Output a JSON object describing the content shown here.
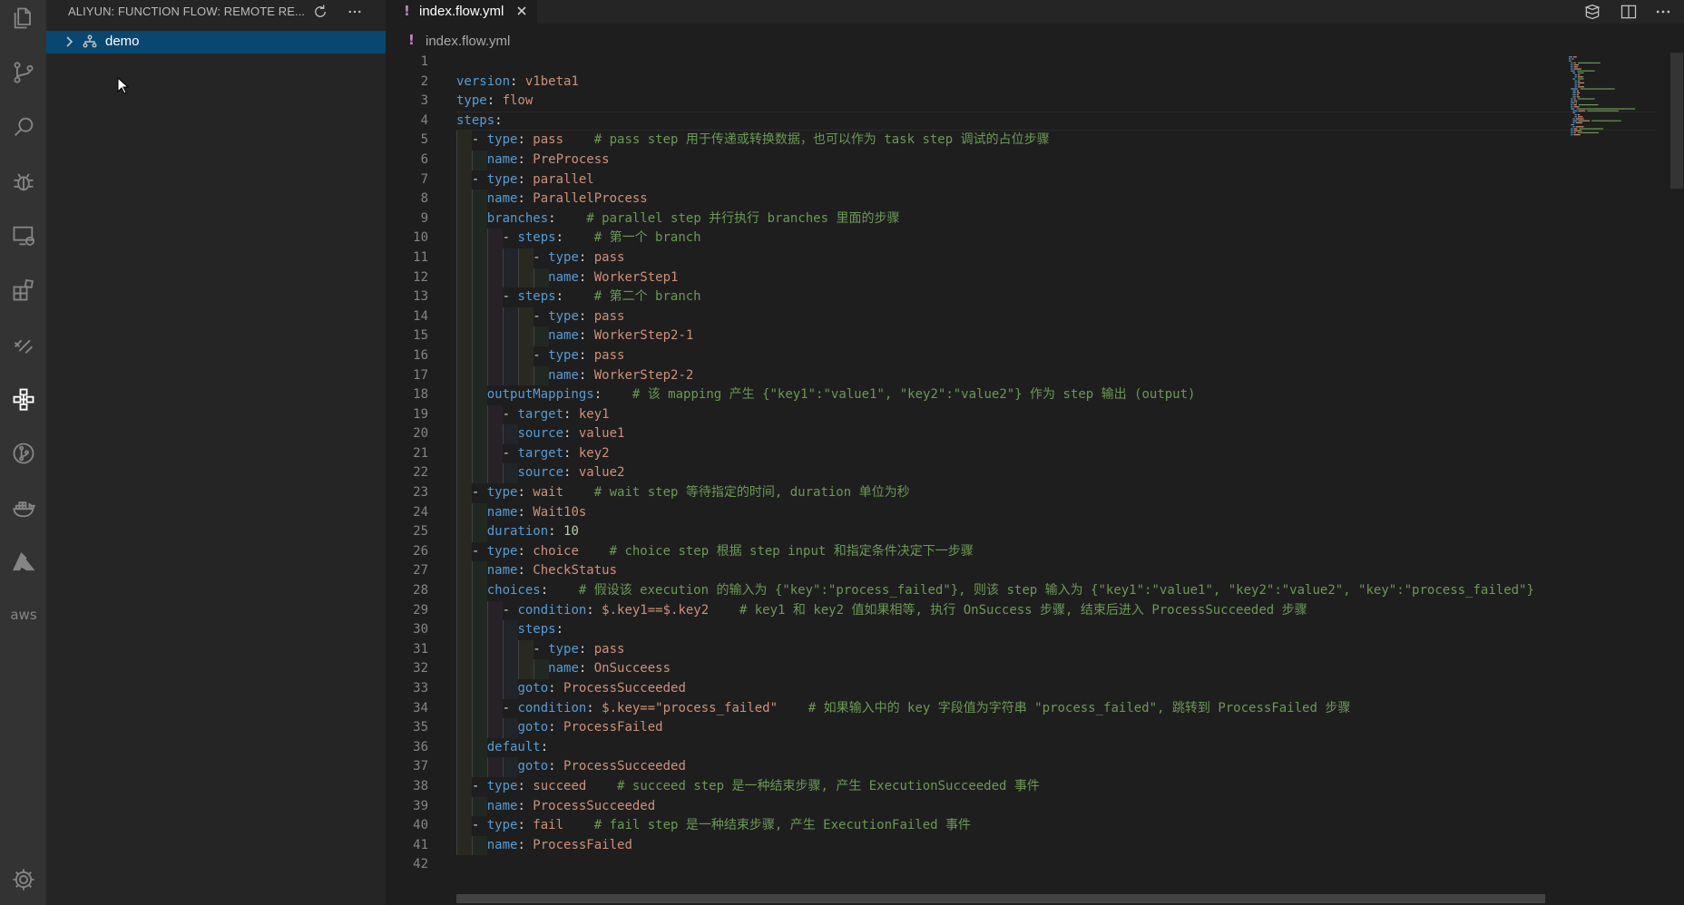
{
  "sidebar": {
    "title": "ALIYUN: FUNCTION FLOW: REMOTE RE...",
    "tree_item_label": "demo"
  },
  "activity_bar": {
    "aws_label": "aws"
  },
  "editor": {
    "tab_marker": "!",
    "tab_label": "index.flow.yml",
    "breadcrumb_marker": "!",
    "breadcrumb_label": "index.flow.yml",
    "lines": [
      {
        "num": "1",
        "tokens": []
      },
      {
        "num": "2",
        "tokens": [
          {
            "t": "k",
            "s": "version"
          },
          {
            "t": "p",
            "s": ": "
          },
          {
            "t": "v",
            "s": "v1beta1"
          }
        ]
      },
      {
        "num": "3",
        "tokens": [
          {
            "t": "k",
            "s": "type"
          },
          {
            "t": "p",
            "s": ": "
          },
          {
            "t": "v",
            "s": "flow"
          }
        ]
      },
      {
        "num": "4",
        "tokens": [
          {
            "t": "k",
            "s": "steps"
          },
          {
            "t": "p",
            "s": ":"
          }
        ]
      },
      {
        "num": "5",
        "tokens": [
          {
            "t": "p",
            "s": "  - "
          },
          {
            "t": "k",
            "s": "type"
          },
          {
            "t": "p",
            "s": ": "
          },
          {
            "t": "v",
            "s": "pass"
          },
          {
            "t": "p",
            "s": "    "
          },
          {
            "t": "c",
            "s": "# pass step 用于传递或转换数据，也可以作为 task step 调试的占位步骤"
          }
        ]
      },
      {
        "num": "6",
        "tokens": [
          {
            "t": "p",
            "s": "    "
          },
          {
            "t": "k",
            "s": "name"
          },
          {
            "t": "p",
            "s": ": "
          },
          {
            "t": "v",
            "s": "PreProcess"
          }
        ]
      },
      {
        "num": "7",
        "tokens": [
          {
            "t": "p",
            "s": "  - "
          },
          {
            "t": "k",
            "s": "type"
          },
          {
            "t": "p",
            "s": ": "
          },
          {
            "t": "v",
            "s": "parallel"
          }
        ]
      },
      {
        "num": "8",
        "tokens": [
          {
            "t": "p",
            "s": "    "
          },
          {
            "t": "k",
            "s": "name"
          },
          {
            "t": "p",
            "s": ": "
          },
          {
            "t": "v",
            "s": "ParallelProcess"
          }
        ]
      },
      {
        "num": "9",
        "tokens": [
          {
            "t": "p",
            "s": "    "
          },
          {
            "t": "k",
            "s": "branches"
          },
          {
            "t": "p",
            "s": ":    "
          },
          {
            "t": "c",
            "s": "# parallel step 并行执行 branches 里面的步骤"
          }
        ]
      },
      {
        "num": "10",
        "tokens": [
          {
            "t": "p",
            "s": "      - "
          },
          {
            "t": "k",
            "s": "steps"
          },
          {
            "t": "p",
            "s": ":    "
          },
          {
            "t": "c",
            "s": "# 第一个 branch"
          }
        ]
      },
      {
        "num": "11",
        "tokens": [
          {
            "t": "p",
            "s": "          - "
          },
          {
            "t": "k",
            "s": "type"
          },
          {
            "t": "p",
            "s": ": "
          },
          {
            "t": "v",
            "s": "pass"
          }
        ]
      },
      {
        "num": "12",
        "tokens": [
          {
            "t": "p",
            "s": "            "
          },
          {
            "t": "k",
            "s": "name"
          },
          {
            "t": "p",
            "s": ": "
          },
          {
            "t": "v",
            "s": "WorkerStep1"
          }
        ]
      },
      {
        "num": "13",
        "tokens": [
          {
            "t": "p",
            "s": "      - "
          },
          {
            "t": "k",
            "s": "steps"
          },
          {
            "t": "p",
            "s": ":    "
          },
          {
            "t": "c",
            "s": "# 第二个 branch"
          }
        ]
      },
      {
        "num": "14",
        "tokens": [
          {
            "t": "p",
            "s": "          - "
          },
          {
            "t": "k",
            "s": "type"
          },
          {
            "t": "p",
            "s": ": "
          },
          {
            "t": "v",
            "s": "pass"
          }
        ]
      },
      {
        "num": "15",
        "tokens": [
          {
            "t": "p",
            "s": "            "
          },
          {
            "t": "k",
            "s": "name"
          },
          {
            "t": "p",
            "s": ": "
          },
          {
            "t": "v",
            "s": "WorkerStep2-1"
          }
        ]
      },
      {
        "num": "16",
        "tokens": [
          {
            "t": "p",
            "s": "          - "
          },
          {
            "t": "k",
            "s": "type"
          },
          {
            "t": "p",
            "s": ": "
          },
          {
            "t": "v",
            "s": "pass"
          }
        ]
      },
      {
        "num": "17",
        "tokens": [
          {
            "t": "p",
            "s": "            "
          },
          {
            "t": "k",
            "s": "name"
          },
          {
            "t": "p",
            "s": ": "
          },
          {
            "t": "v",
            "s": "WorkerStep2-2"
          }
        ]
      },
      {
        "num": "18",
        "tokens": [
          {
            "t": "p",
            "s": "    "
          },
          {
            "t": "k",
            "s": "outputMappings"
          },
          {
            "t": "p",
            "s": ":    "
          },
          {
            "t": "c",
            "s": "# 该 mapping 产生 {\"key1\":\"value1\", \"key2\":\"value2\"} 作为 step 输出 (output)"
          }
        ]
      },
      {
        "num": "19",
        "tokens": [
          {
            "t": "p",
            "s": "      - "
          },
          {
            "t": "k",
            "s": "target"
          },
          {
            "t": "p",
            "s": ": "
          },
          {
            "t": "v",
            "s": "key1"
          }
        ]
      },
      {
        "num": "20",
        "tokens": [
          {
            "t": "p",
            "s": "        "
          },
          {
            "t": "k",
            "s": "source"
          },
          {
            "t": "p",
            "s": ": "
          },
          {
            "t": "v",
            "s": "value1"
          }
        ]
      },
      {
        "num": "21",
        "tokens": [
          {
            "t": "p",
            "s": "      - "
          },
          {
            "t": "k",
            "s": "target"
          },
          {
            "t": "p",
            "s": ": "
          },
          {
            "t": "v",
            "s": "key2"
          }
        ]
      },
      {
        "num": "22",
        "tokens": [
          {
            "t": "p",
            "s": "        "
          },
          {
            "t": "k",
            "s": "source"
          },
          {
            "t": "p",
            "s": ": "
          },
          {
            "t": "v",
            "s": "value2"
          }
        ]
      },
      {
        "num": "23",
        "tokens": [
          {
            "t": "p",
            "s": "  - "
          },
          {
            "t": "k",
            "s": "type"
          },
          {
            "t": "p",
            "s": ": "
          },
          {
            "t": "v",
            "s": "wait"
          },
          {
            "t": "p",
            "s": "    "
          },
          {
            "t": "c",
            "s": "# wait step 等待指定的时间, duration 单位为秒"
          }
        ]
      },
      {
        "num": "24",
        "tokens": [
          {
            "t": "p",
            "s": "    "
          },
          {
            "t": "k",
            "s": "name"
          },
          {
            "t": "p",
            "s": ": "
          },
          {
            "t": "v",
            "s": "Wait10s"
          }
        ]
      },
      {
        "num": "25",
        "tokens": [
          {
            "t": "p",
            "s": "    "
          },
          {
            "t": "k",
            "s": "duration"
          },
          {
            "t": "p",
            "s": ": "
          },
          {
            "t": "n",
            "s": "10"
          }
        ]
      },
      {
        "num": "26",
        "tokens": [
          {
            "t": "p",
            "s": "  - "
          },
          {
            "t": "k",
            "s": "type"
          },
          {
            "t": "p",
            "s": ": "
          },
          {
            "t": "v",
            "s": "choice"
          },
          {
            "t": "p",
            "s": "    "
          },
          {
            "t": "c",
            "s": "# choice step 根据 step input 和指定条件决定下一步骤"
          }
        ]
      },
      {
        "num": "27",
        "tokens": [
          {
            "t": "p",
            "s": "    "
          },
          {
            "t": "k",
            "s": "name"
          },
          {
            "t": "p",
            "s": ": "
          },
          {
            "t": "v",
            "s": "CheckStatus"
          }
        ]
      },
      {
        "num": "28",
        "tokens": [
          {
            "t": "p",
            "s": "    "
          },
          {
            "t": "k",
            "s": "choices"
          },
          {
            "t": "p",
            "s": ":    "
          },
          {
            "t": "c",
            "s": "# 假设该 execution 的输入为 {\"key\":\"process_failed\"}, 则该 step 输入为 {\"key1\":\"value1\", \"key2\":\"value2\", \"key\":\"process_failed\"}"
          }
        ]
      },
      {
        "num": "29",
        "tokens": [
          {
            "t": "p",
            "s": "      - "
          },
          {
            "t": "k",
            "s": "condition"
          },
          {
            "t": "p",
            "s": ": "
          },
          {
            "t": "v",
            "s": "$.key1==$.key2"
          },
          {
            "t": "p",
            "s": "    "
          },
          {
            "t": "c",
            "s": "# key1 和 key2 值如果相等, 执行 OnSuccess 步骤, 结束后进入 ProcessSucceeded 步骤"
          }
        ]
      },
      {
        "num": "30",
        "tokens": [
          {
            "t": "p",
            "s": "        "
          },
          {
            "t": "k",
            "s": "steps"
          },
          {
            "t": "p",
            "s": ":"
          }
        ]
      },
      {
        "num": "31",
        "tokens": [
          {
            "t": "p",
            "s": "          - "
          },
          {
            "t": "k",
            "s": "type"
          },
          {
            "t": "p",
            "s": ": "
          },
          {
            "t": "v",
            "s": "pass"
          }
        ]
      },
      {
        "num": "32",
        "tokens": [
          {
            "t": "p",
            "s": "            "
          },
          {
            "t": "k",
            "s": "name"
          },
          {
            "t": "p",
            "s": ": "
          },
          {
            "t": "v",
            "s": "OnSucceess"
          }
        ]
      },
      {
        "num": "33",
        "tokens": [
          {
            "t": "p",
            "s": "        "
          },
          {
            "t": "k",
            "s": "goto"
          },
          {
            "t": "p",
            "s": ": "
          },
          {
            "t": "v",
            "s": "ProcessSucceeded"
          }
        ]
      },
      {
        "num": "34",
        "tokens": [
          {
            "t": "p",
            "s": "      - "
          },
          {
            "t": "k",
            "s": "condition"
          },
          {
            "t": "p",
            "s": ": "
          },
          {
            "t": "v",
            "s": "$.key==\"process_failed\""
          },
          {
            "t": "p",
            "s": "    "
          },
          {
            "t": "c",
            "s": "# 如果输入中的 key 字段值为字符串 \"process_failed\", 跳转到 ProcessFailed 步骤"
          }
        ]
      },
      {
        "num": "35",
        "tokens": [
          {
            "t": "p",
            "s": "        "
          },
          {
            "t": "k",
            "s": "goto"
          },
          {
            "t": "p",
            "s": ": "
          },
          {
            "t": "v",
            "s": "ProcessFailed"
          }
        ]
      },
      {
        "num": "36",
        "tokens": [
          {
            "t": "p",
            "s": "    "
          },
          {
            "t": "k",
            "s": "default"
          },
          {
            "t": "p",
            "s": ":"
          }
        ]
      },
      {
        "num": "37",
        "tokens": [
          {
            "t": "p",
            "s": "        "
          },
          {
            "t": "k",
            "s": "goto"
          },
          {
            "t": "p",
            "s": ": "
          },
          {
            "t": "v",
            "s": "ProcessSucceeded"
          }
        ]
      },
      {
        "num": "38",
        "tokens": [
          {
            "t": "p",
            "s": "  - "
          },
          {
            "t": "k",
            "s": "type"
          },
          {
            "t": "p",
            "s": ": "
          },
          {
            "t": "v",
            "s": "succeed"
          },
          {
            "t": "p",
            "s": "    "
          },
          {
            "t": "c",
            "s": "# succeed step 是一种结束步骤, 产生 ExecutionSucceeded 事件"
          }
        ]
      },
      {
        "num": "39",
        "tokens": [
          {
            "t": "p",
            "s": "    "
          },
          {
            "t": "k",
            "s": "name"
          },
          {
            "t": "p",
            "s": ": "
          },
          {
            "t": "v",
            "s": "ProcessSucceeded"
          }
        ]
      },
      {
        "num": "40",
        "tokens": [
          {
            "t": "p",
            "s": "  - "
          },
          {
            "t": "k",
            "s": "type"
          },
          {
            "t": "p",
            "s": ": "
          },
          {
            "t": "v",
            "s": "fail"
          },
          {
            "t": "p",
            "s": "    "
          },
          {
            "t": "c",
            "s": "# fail step 是一种结束步骤, 产生 ExecutionFailed 事件"
          }
        ]
      },
      {
        "num": "41",
        "tokens": [
          {
            "t": "p",
            "s": "    "
          },
          {
            "t": "k",
            "s": "name"
          },
          {
            "t": "p",
            "s": ": "
          },
          {
            "t": "v",
            "s": "ProcessFailed"
          }
        ]
      },
      {
        "num": "42",
        "tokens": []
      }
    ]
  }
}
